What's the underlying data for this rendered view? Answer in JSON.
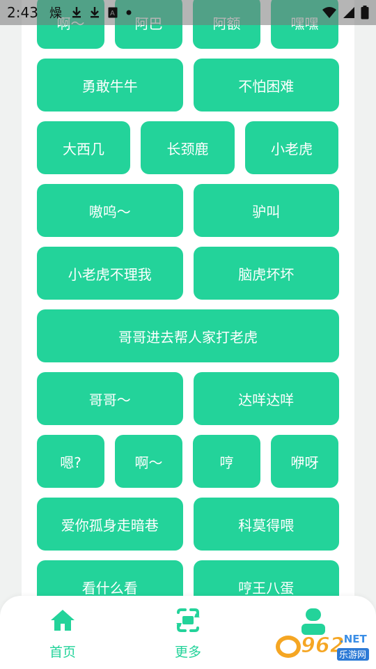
{
  "status_bar": {
    "time": "2:43",
    "icons": [
      "hot-icon",
      "download-icon",
      "download-icon",
      "a-icon",
      "dot-icon"
    ],
    "right_icons": [
      "wifi-icon",
      "signal-icon",
      "battery-icon"
    ]
  },
  "grid": {
    "row0": [
      "啊～",
      "阿巴",
      "阿额",
      "嘿嘿"
    ],
    "row1": [
      "勇敢牛牛",
      "不怕困难"
    ],
    "row2": [
      "大西几",
      "长颈鹿",
      "小老虎"
    ],
    "row3": [
      "嗷呜～",
      "驴叫"
    ],
    "row4": [
      "小老虎不理我",
      "脑虎坏坏"
    ],
    "row5": [
      "哥哥进去帮人家打老虎"
    ],
    "row6": [
      "哥哥～",
      "达咩达咩"
    ],
    "row7": [
      "嗯?",
      "啊～",
      "哼",
      "咿呀"
    ],
    "row8": [
      "爱你孤身走暗巷",
      "科莫得喂"
    ],
    "row9": [
      "看什么看",
      "哼王八蛋"
    ]
  },
  "nav": {
    "home": "首页",
    "more": "更多"
  },
  "watermark": {
    "brand": "962",
    "suffix": ".NET",
    "site": "乐游网"
  },
  "colors": {
    "accent": "#23d39a",
    "background": "#f0f2f1"
  }
}
